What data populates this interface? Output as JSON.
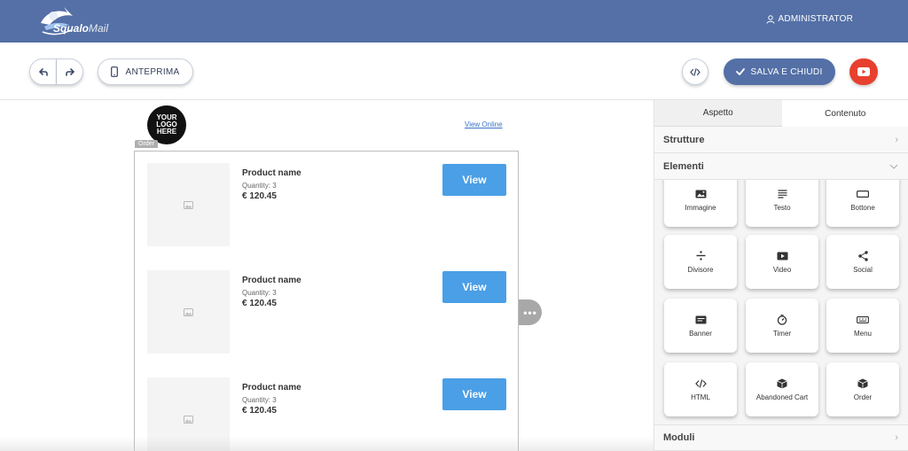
{
  "brand": {
    "logo_text": "Squalo",
    "logo_text_thin": "Mail"
  },
  "header": {
    "user_label": "ADMINISTRATOR"
  },
  "toolbar": {
    "preview_label": "ANTEPRIMA",
    "save_label": "SALVA E CHIUDI"
  },
  "email": {
    "logo_lines": [
      "YOUR",
      "LOGO",
      "HERE"
    ],
    "view_online": "View Online",
    "block_tag": "Order",
    "products": [
      {
        "name": "Product name",
        "quantity": "Quantity: 3",
        "price": "€ 120.45",
        "button": "View"
      },
      {
        "name": "Product name",
        "quantity": "Quantity: 3",
        "price": "€ 120.45",
        "button": "View"
      },
      {
        "name": "Product name",
        "quantity": "Quantity: 3",
        "price": "€ 120.45",
        "button": "View"
      }
    ]
  },
  "panel": {
    "tabs": [
      "Aspetto",
      "Contenuto"
    ],
    "sections": {
      "strutture": "Strutture",
      "elementi": "Elementi",
      "moduli": "Moduli"
    },
    "elements": [
      {
        "label": "Immagine",
        "icon": "image-icon"
      },
      {
        "label": "Testo",
        "icon": "text-icon"
      },
      {
        "label": "Bottone",
        "icon": "button-icon"
      },
      {
        "label": "Divisore",
        "icon": "divider-icon"
      },
      {
        "label": "Video",
        "icon": "video-icon"
      },
      {
        "label": "Social",
        "icon": "share-icon"
      },
      {
        "label": "Banner",
        "icon": "banner-icon"
      },
      {
        "label": "Timer",
        "icon": "timer-icon"
      },
      {
        "label": "Menu",
        "icon": "menu-icon"
      },
      {
        "label": "HTML",
        "icon": "code-icon"
      },
      {
        "label": "Abandoned Cart",
        "icon": "box-icon"
      },
      {
        "label": "Order",
        "icon": "box-icon"
      }
    ]
  },
  "colors": {
    "header_bg": "#5470a6",
    "accent_button": "#4a9fe6",
    "youtube_red": "#e8402f"
  }
}
